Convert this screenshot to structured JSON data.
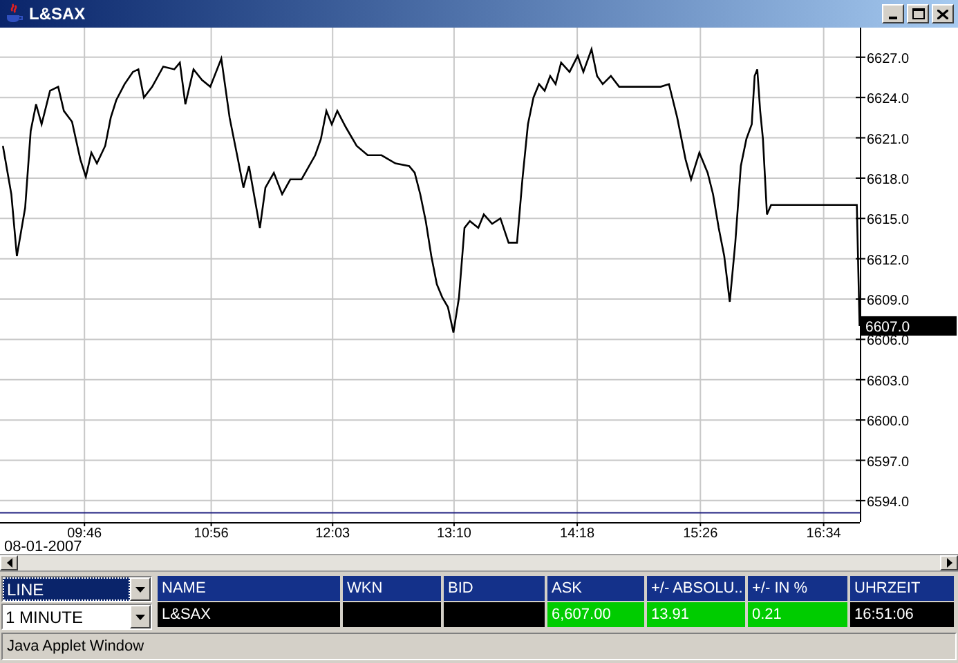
{
  "window": {
    "title": "L&SAX"
  },
  "chart": {
    "chart_data": {
      "type": "line",
      "xlim": [
        8.99,
        16.9
      ],
      "ylim": [
        6592.4,
        6629.2
      ],
      "x": [
        9.017,
        9.094,
        9.145,
        9.221,
        9.272,
        9.322,
        9.373,
        9.45,
        9.526,
        9.577,
        9.653,
        9.729,
        9.78,
        9.831,
        9.882,
        9.958,
        10.009,
        10.06,
        10.136,
        10.212,
        10.263,
        10.314,
        10.39,
        10.492,
        10.593,
        10.644,
        10.695,
        10.771,
        10.848,
        10.924,
        11.026,
        11.102,
        11.178,
        11.229,
        11.28,
        11.381,
        11.432,
        11.509,
        11.585,
        11.661,
        11.763,
        11.89,
        11.941,
        11.992,
        12.042,
        12.093,
        12.17,
        12.271,
        12.373,
        12.5,
        12.627,
        12.754,
        12.805,
        12.856,
        12.907,
        12.958,
        13.008,
        13.059,
        13.11,
        13.161,
        13.212,
        13.263,
        13.313,
        13.39,
        13.441,
        13.517,
        13.593,
        13.669,
        13.746,
        13.796,
        13.847,
        13.898,
        13.949,
        14.0,
        14.051,
        14.101,
        14.152,
        14.229,
        14.305,
        14.356,
        14.432,
        14.483,
        14.534,
        14.61,
        14.686,
        14.762,
        14.839,
        14.915,
        14.991,
        15.067,
        15.144,
        15.22,
        15.296,
        15.347,
        15.423,
        15.5,
        15.55,
        15.601,
        15.652,
        15.703,
        15.754,
        15.805,
        15.856,
        15.906,
        15.932,
        15.957,
        15.983,
        16.008,
        16.046,
        16.084,
        16.237,
        16.491,
        16.872,
        16.898
      ],
      "series": [
        {
          "color": "#000000",
          "values": [
            6620.4,
            6616.8,
            6612.2,
            6615.8,
            6621.5,
            6623.5,
            6622.0,
            6624.5,
            6624.8,
            6623.0,
            6622.2,
            6619.4,
            6618.1,
            6619.9,
            6619.1,
            6620.4,
            6622.5,
            6623.8,
            6625.0,
            6625.9,
            6626.1,
            6624.0,
            6624.8,
            6626.3,
            6626.1,
            6626.6,
            6623.5,
            6626.1,
            6625.3,
            6624.8,
            6626.9,
            6622.5,
            6619.4,
            6617.3,
            6618.9,
            6614.3,
            6617.3,
            6618.4,
            6616.8,
            6617.9,
            6617.9,
            6619.7,
            6620.9,
            6623.0,
            6622.0,
            6623.0,
            6621.8,
            6620.4,
            6619.7,
            6619.7,
            6619.1,
            6618.9,
            6618.4,
            6616.8,
            6614.8,
            6612.2,
            6610.1,
            6609.1,
            6608.4,
            6606.5,
            6609.1,
            6614.3,
            6614.8,
            6614.3,
            6615.3,
            6614.6,
            6615.0,
            6613.2,
            6613.2,
            6617.9,
            6622.0,
            6624.0,
            6625.0,
            6624.5,
            6625.6,
            6625.0,
            6626.6,
            6625.9,
            6627.1,
            6625.9,
            6627.6,
            6625.6,
            6625.0,
            6625.6,
            6624.8,
            6624.8,
            6624.8,
            6624.8,
            6624.8,
            6624.8,
            6625.0,
            6622.5,
            6619.4,
            6617.9,
            6619.9,
            6618.4,
            6616.8,
            6614.3,
            6612.2,
            6608.8,
            6613.2,
            6618.9,
            6620.9,
            6622.0,
            6625.6,
            6626.1,
            6623.0,
            6620.9,
            6615.3,
            6616.0,
            6616.0,
            6616.0,
            6616.0,
            6607.0
          ]
        }
      ],
      "xticks": [
        {
          "value": 9.767,
          "label": "09:46"
        },
        {
          "value": 10.933,
          "label": "10:56"
        },
        {
          "value": 12.05,
          "label": "12:03"
        },
        {
          "value": 13.167,
          "label": "13:10"
        },
        {
          "value": 14.3,
          "label": "14:18"
        },
        {
          "value": 15.433,
          "label": "15:26"
        },
        {
          "value": 16.567,
          "label": "16:34"
        }
      ],
      "yticks": [
        {
          "value": 6627,
          "label": "6627.0"
        },
        {
          "value": 6624,
          "label": "6624.0"
        },
        {
          "value": 6621,
          "label": "6621.0"
        },
        {
          "value": 6618,
          "label": "6618.0"
        },
        {
          "value": 6615,
          "label": "6615.0"
        },
        {
          "value": 6612,
          "label": "6612.0"
        },
        {
          "value": 6609,
          "label": "6609.0"
        },
        {
          "value": 6606,
          "label": "6606.0"
        },
        {
          "value": 6603,
          "label": "6603.0"
        },
        {
          "value": 6600,
          "label": "6600.0"
        },
        {
          "value": 6597,
          "label": "6597.0"
        },
        {
          "value": 6594,
          "label": "6594.0"
        }
      ],
      "annotations": [
        "6607.0"
      ],
      "grid": true,
      "ref_lines": [
        {
          "axis": "y",
          "value": 6593.1,
          "color": "#202080"
        }
      ]
    },
    "date": "08-01-2007"
  },
  "controls": [
    {
      "value": "LINE",
      "focused": true
    },
    {
      "value": "1 MINUTE",
      "focused": false
    }
  ],
  "table": {
    "columns": [
      "NAME",
      "WKN",
      "BID",
      "ASK",
      "+/- ABSOLU..",
      "+/- IN %",
      "UHRZEIT"
    ],
    "rows": [
      {
        "cells": [
          {
            "text": "L&SAX",
            "highlight": false
          },
          {
            "highlight": false
          },
          {
            "highlight": false
          },
          {
            "text": "6,607.00",
            "highlight": true
          },
          {
            "text": "13.91",
            "highlight": true
          },
          {
            "text": "0.21",
            "highlight": true
          },
          {
            "text": "16:51:06",
            "highlight": false
          }
        ]
      }
    ]
  },
  "status_bar": "Java Applet Window"
}
